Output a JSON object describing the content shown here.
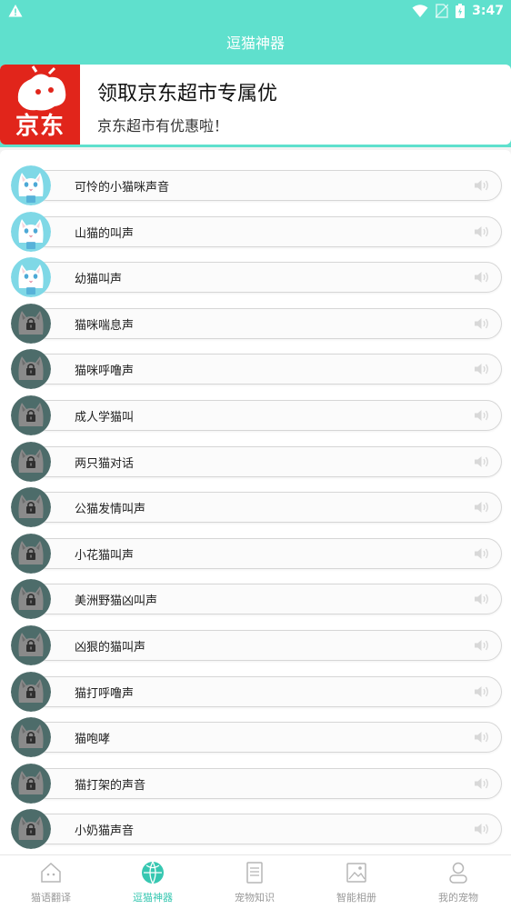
{
  "status_bar": {
    "time": "3:47",
    "icons": [
      "warning-icon",
      "wifi-icon",
      "no-sim-icon",
      "battery-icon"
    ]
  },
  "app_bar": {
    "title": "逗猫神器"
  },
  "banner": {
    "logo_text": "京东",
    "title": "领取京东超市专属优",
    "subtitle": "京东超市有优惠啦！",
    "colors": {
      "logo_bg": "#e1251b"
    }
  },
  "sounds": [
    {
      "label": "可怜的小猫咪声音",
      "locked": false
    },
    {
      "label": "山猫的叫声",
      "locked": false
    },
    {
      "label": "幼猫叫声",
      "locked": false
    },
    {
      "label": "猫咪喘息声",
      "locked": true
    },
    {
      "label": "猫咪呼噜声",
      "locked": true
    },
    {
      "label": "成人学猫叫",
      "locked": true
    },
    {
      "label": "两只猫对话",
      "locked": true
    },
    {
      "label": "公猫发情叫声",
      "locked": true
    },
    {
      "label": "小花猫叫声",
      "locked": true
    },
    {
      "label": "美洲野猫凶叫声",
      "locked": true
    },
    {
      "label": "凶狠的猫叫声",
      "locked": true
    },
    {
      "label": "猫打呼噜声",
      "locked": true
    },
    {
      "label": "猫咆哮",
      "locked": true
    },
    {
      "label": "猫打架的声音",
      "locked": true
    },
    {
      "label": "小奶猫声音",
      "locked": true
    }
  ],
  "tab_bar": {
    "tabs": [
      {
        "label": "猫语翻译",
        "icon": "house-icon",
        "active": false
      },
      {
        "label": "逗猫神器",
        "icon": "ball-icon",
        "active": true
      },
      {
        "label": "宠物知识",
        "icon": "document-icon",
        "active": false
      },
      {
        "label": "智能相册",
        "icon": "photo-icon",
        "active": false
      },
      {
        "label": "我的宠物",
        "icon": "person-icon",
        "active": false
      }
    ]
  },
  "colors": {
    "accent": "#5fe0cd",
    "tab_active": "#37c7b1"
  }
}
